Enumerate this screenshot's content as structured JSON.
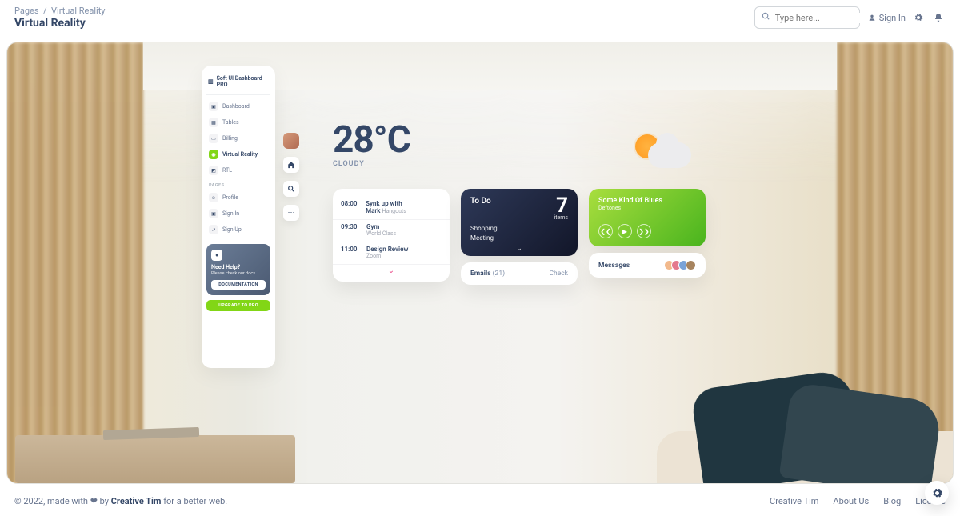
{
  "breadcrumb": {
    "root": "Pages",
    "current": "Virtual Reality"
  },
  "page_title": "Virtual Reality",
  "search": {
    "placeholder": "Type here..."
  },
  "nav": {
    "signin": "Sign In"
  },
  "sidebar": {
    "brand": "Soft UI Dashboard PRO",
    "items": [
      "Dashboard",
      "Tables",
      "Billing",
      "Virtual Reality",
      "RTL"
    ],
    "pages_label": "Pages",
    "pages": [
      "Profile",
      "Sign In",
      "Sign Up"
    ],
    "help": {
      "title": "Need Help?",
      "subtitle": "Please check our docs",
      "button": "DOCUMENTATION"
    },
    "upgrade": "UPGRADE TO PRO"
  },
  "weather": {
    "temp": "28°C",
    "cond": "CLOUDY"
  },
  "schedule": [
    {
      "time": "08:00",
      "title": "Synk up with Mark",
      "sub": "Hangouts"
    },
    {
      "time": "09:30",
      "title": "Gym",
      "sub2": "World Class"
    },
    {
      "time": "11:00",
      "title": "Design Review",
      "sub2": "Zoom"
    }
  ],
  "todo": {
    "label": "To Do",
    "count": "7",
    "items_label": "items",
    "items": [
      "Shopping",
      "Meeting"
    ]
  },
  "emails": {
    "label": "Emails",
    "count": "(21)",
    "action": "Check"
  },
  "music": {
    "title": "Some Kind Of Blues",
    "artist": "Deftones"
  },
  "messages": {
    "label": "Messages"
  },
  "footer": {
    "text1": "© 2022, made with ",
    "text2": " by ",
    "brand": "Creative Tim",
    "text3": " for a better web.",
    "links": [
      "Creative Tim",
      "About Us",
      "Blog",
      "License"
    ]
  }
}
